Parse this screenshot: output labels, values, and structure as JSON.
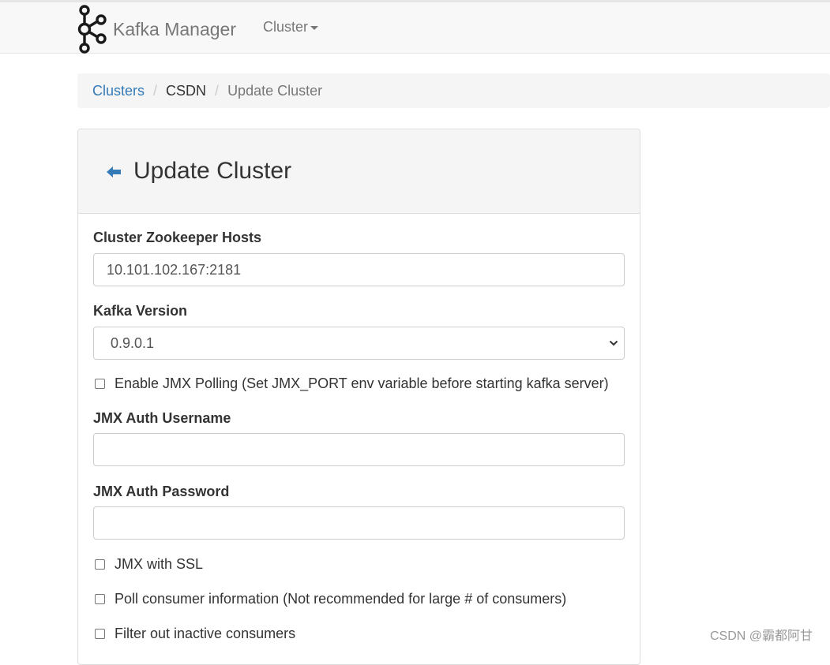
{
  "navbar": {
    "brand": "Kafka Manager",
    "cluster_menu": "Cluster"
  },
  "breadcrumb": {
    "items": [
      "Clusters",
      "CSDN",
      "Update Cluster"
    ],
    "separator": "/"
  },
  "panel": {
    "title": "Update Cluster"
  },
  "form": {
    "zk_hosts": {
      "label": "Cluster Zookeeper Hosts",
      "value": "10.101.102.167:2181"
    },
    "kafka_version": {
      "label": "Kafka Version",
      "value": "0.9.0.1"
    },
    "enable_jmx": {
      "label": "Enable JMX Polling (Set JMX_PORT env variable before starting kafka server)",
      "checked": false
    },
    "jmx_user": {
      "label": "JMX Auth Username",
      "value": ""
    },
    "jmx_pass": {
      "label": "JMX Auth Password",
      "value": ""
    },
    "jmx_ssl": {
      "label": "JMX with SSL",
      "checked": false
    },
    "poll_consumers": {
      "label": "Poll consumer information (Not recommended for large # of consumers)",
      "checked": false
    },
    "filter_inactive": {
      "label": "Filter out inactive consumers",
      "checked": false
    }
  },
  "watermark": "CSDN @霸都阿甘",
  "colors": {
    "link": "#337ab7",
    "navbar_bg": "#f8f8f8",
    "panel_heading_bg": "#f5f5f5"
  },
  "icons": {
    "brand_logo": "kafka-logo-icon",
    "back": "arrow-left-icon",
    "dropdown": "chevron-down-icon"
  }
}
